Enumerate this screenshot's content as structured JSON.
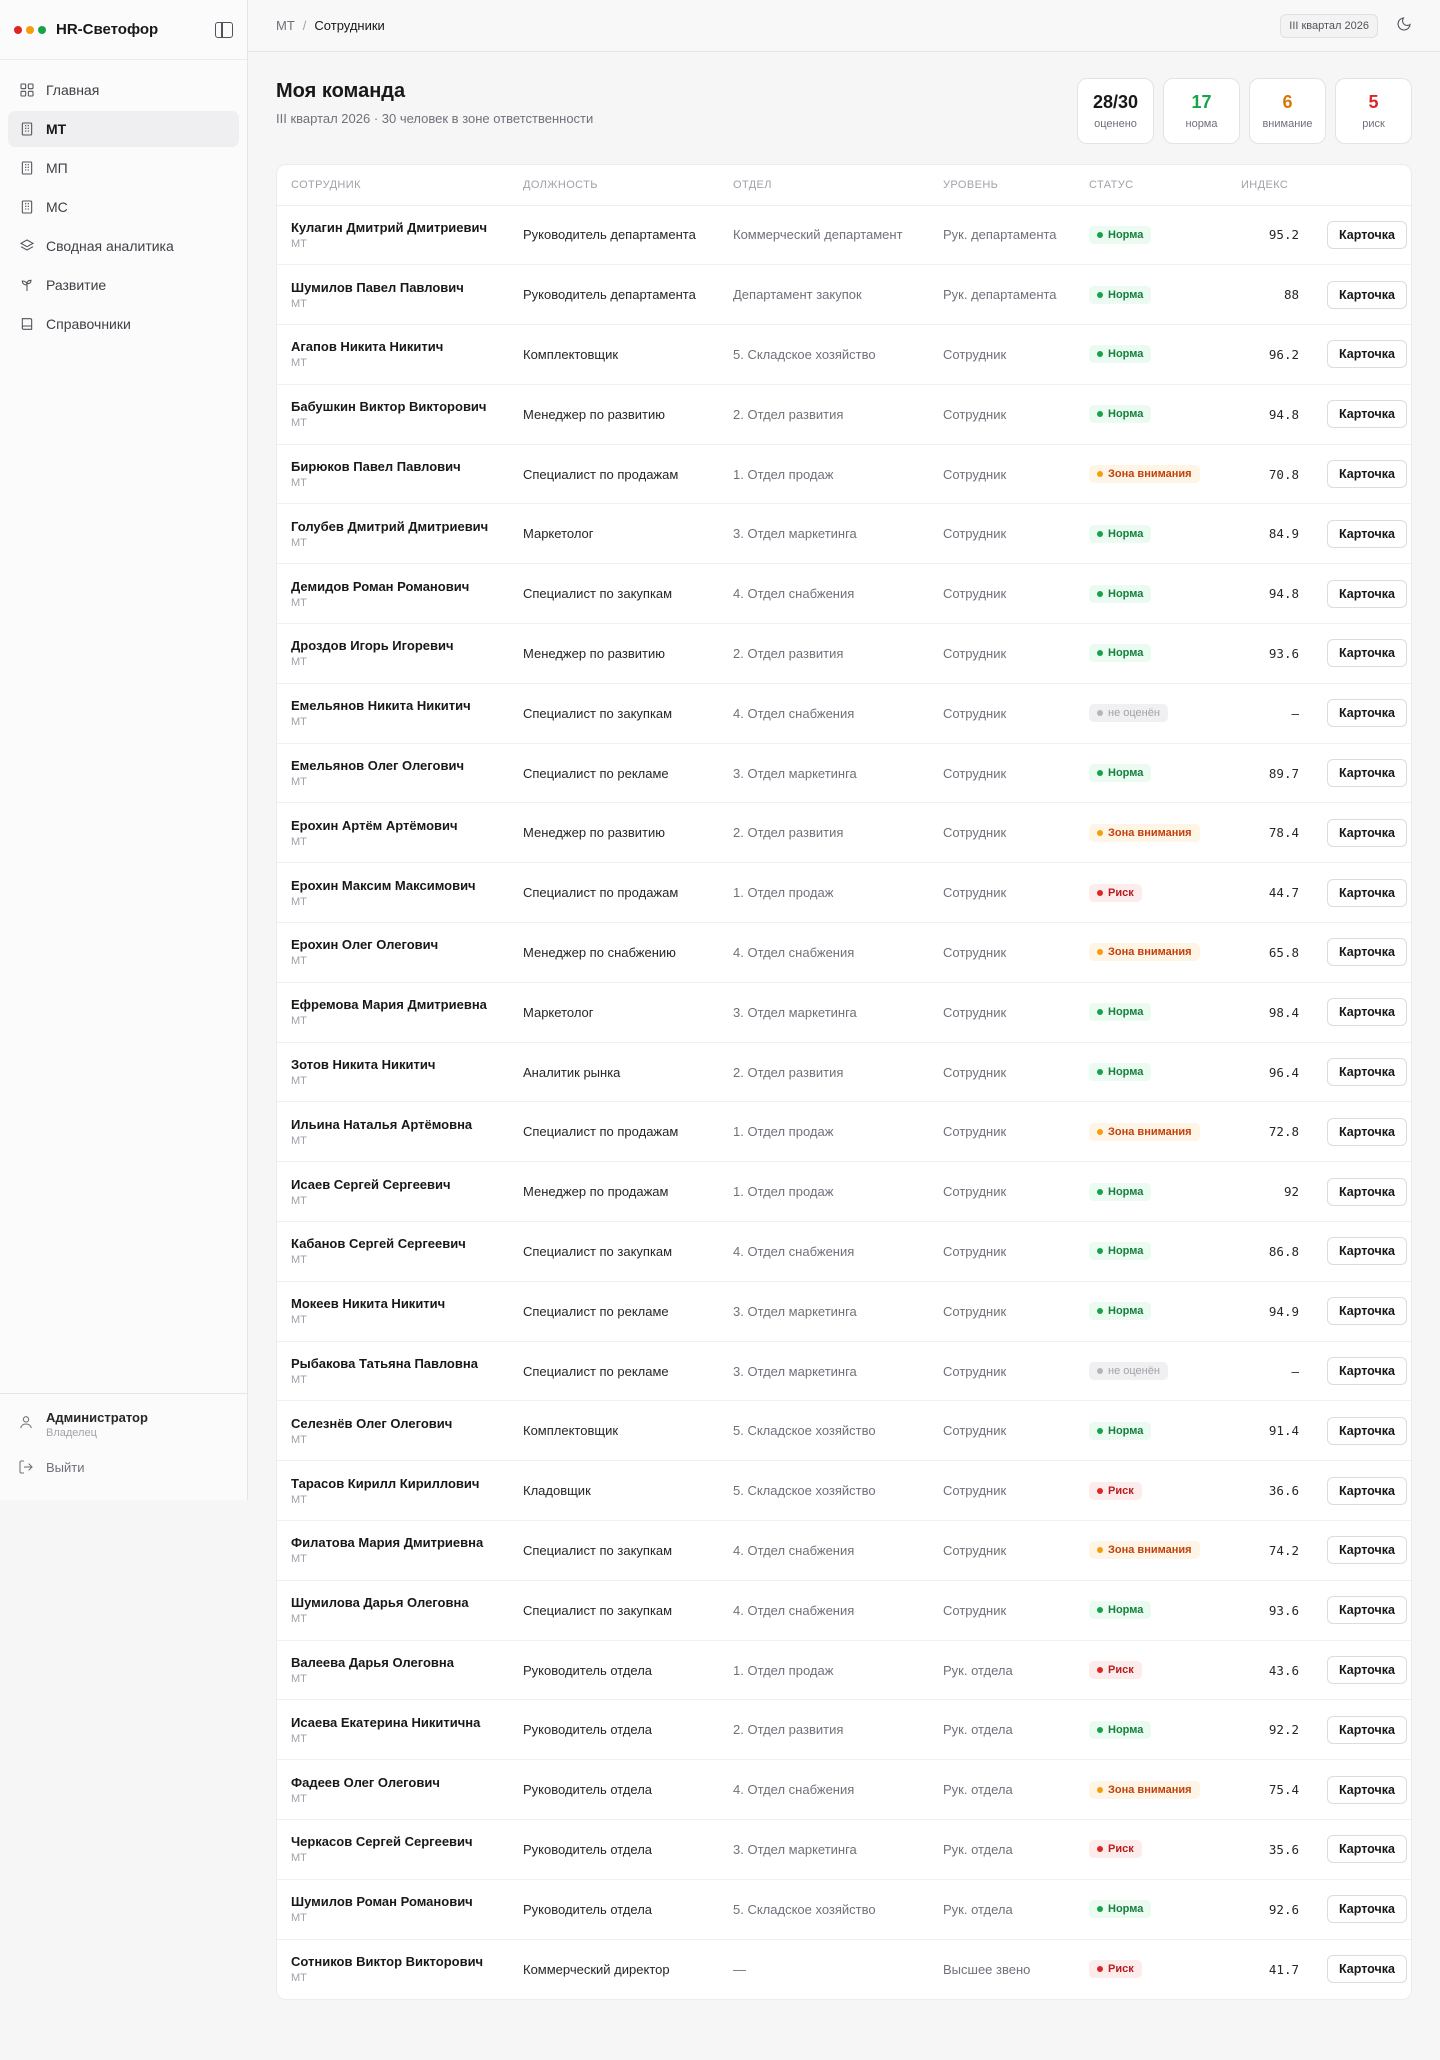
{
  "app": {
    "title": "HR-Светофор",
    "dots": [
      "#dc2626",
      "#f59e0b",
      "#16a34a"
    ]
  },
  "sidebar": {
    "items": [
      {
        "label": "Главная",
        "icon": "grid-icon",
        "active": false
      },
      {
        "label": "МТ",
        "icon": "building-icon",
        "active": true
      },
      {
        "label": "МП",
        "icon": "building-icon",
        "active": false
      },
      {
        "label": "МС",
        "icon": "building-icon",
        "active": false
      },
      {
        "label": "Сводная аналитика",
        "icon": "layers-icon",
        "active": false
      },
      {
        "label": "Развитие",
        "icon": "sprout-icon",
        "active": false
      },
      {
        "label": "Справочники",
        "icon": "book-icon",
        "active": false
      }
    ],
    "user": {
      "name": "Администратор",
      "role": "Владелец"
    },
    "logout": "Выйти"
  },
  "topbar": {
    "breadcrumb": [
      "МТ",
      "Сотрудники"
    ],
    "period": "III квартал 2026"
  },
  "page": {
    "title": "Моя команда",
    "subtitle": "III квартал 2026 · 30 человек в зоне ответственности",
    "stats": [
      {
        "value": "28/30",
        "label": "оценено",
        "color": "#18181b"
      },
      {
        "value": "17",
        "label": "норма",
        "color": "#16a34a"
      },
      {
        "value": "6",
        "label": "внимание",
        "color": "#d97706"
      },
      {
        "value": "5",
        "label": "риск",
        "color": "#dc2626"
      }
    ]
  },
  "table": {
    "columns": [
      "СОТРУДНИК",
      "ДОЛЖНОСТЬ",
      "ОТДЕЛ",
      "УРОВЕНЬ",
      "СТАТУС",
      "ИНДЕКС",
      ""
    ],
    "button_label": "Карточка",
    "rows": [
      {
        "name": "Кулагин Дмитрий Дмитриевич",
        "org": "МТ",
        "position": "Руководитель департамента",
        "dept": "Коммерческий департамент",
        "level": "Рук. департамента",
        "status": "Норма",
        "status_type": "norm",
        "index": "95.2"
      },
      {
        "name": "Шумилов Павел Павлович",
        "org": "МТ",
        "position": "Руководитель департамента",
        "dept": "Департамент закупок",
        "level": "Рук. департамента",
        "status": "Норма",
        "status_type": "norm",
        "index": "88"
      },
      {
        "name": "Агапов Никита Никитич",
        "org": "МТ",
        "position": "Комплектовщик",
        "dept": "5. Складское хозяйство",
        "level": "Сотрудник",
        "status": "Норма",
        "status_type": "norm",
        "index": "96.2"
      },
      {
        "name": "Бабушкин Виктор Викторович",
        "org": "МТ",
        "position": "Менеджер по развитию",
        "dept": "2. Отдел развития",
        "level": "Сотрудник",
        "status": "Норма",
        "status_type": "norm",
        "index": "94.8"
      },
      {
        "name": "Бирюков Павел Павлович",
        "org": "МТ",
        "position": "Специалист по продажам",
        "dept": "1. Отдел продаж",
        "level": "Сотрудник",
        "status": "Зона внимания",
        "status_type": "att",
        "index": "70.8"
      },
      {
        "name": "Голубев Дмитрий Дмитриевич",
        "org": "МТ",
        "position": "Маркетолог",
        "dept": "3. Отдел маркетинга",
        "level": "Сотрудник",
        "status": "Норма",
        "status_type": "norm",
        "index": "84.9"
      },
      {
        "name": "Демидов Роман Романович",
        "org": "МТ",
        "position": "Специалист по закупкам",
        "dept": "4. Отдел снабжения",
        "level": "Сотрудник",
        "status": "Норма",
        "status_type": "norm",
        "index": "94.8"
      },
      {
        "name": "Дроздов Игорь Игоревич",
        "org": "МТ",
        "position": "Менеджер по развитию",
        "dept": "2. Отдел развития",
        "level": "Сотрудник",
        "status": "Норма",
        "status_type": "norm",
        "index": "93.6"
      },
      {
        "name": "Емельянов Никита Никитич",
        "org": "МТ",
        "position": "Специалист по закупкам",
        "dept": "4. Отдел снабжения",
        "level": "Сотрудник",
        "status": "не оценён",
        "status_type": "none",
        "index": "—"
      },
      {
        "name": "Емельянов Олег Олегович",
        "org": "МТ",
        "position": "Специалист по рекламе",
        "dept": "3. Отдел маркетинга",
        "level": "Сотрудник",
        "status": "Норма",
        "status_type": "norm",
        "index": "89.7"
      },
      {
        "name": "Ерохин Артём Артёмович",
        "org": "МТ",
        "position": "Менеджер по развитию",
        "dept": "2. Отдел развития",
        "level": "Сотрудник",
        "status": "Зона внимания",
        "status_type": "att",
        "index": "78.4"
      },
      {
        "name": "Ерохин Максим Максимович",
        "org": "МТ",
        "position": "Специалист по продажам",
        "dept": "1. Отдел продаж",
        "level": "Сотрудник",
        "status": "Риск",
        "status_type": "risk",
        "index": "44.7"
      },
      {
        "name": "Ерохин Олег Олегович",
        "org": "МТ",
        "position": "Менеджер по снабжению",
        "dept": "4. Отдел снабжения",
        "level": "Сотрудник",
        "status": "Зона внимания",
        "status_type": "att",
        "index": "65.8"
      },
      {
        "name": "Ефремова Мария Дмитриевна",
        "org": "МТ",
        "position": "Маркетолог",
        "dept": "3. Отдел маркетинга",
        "level": "Сотрудник",
        "status": "Норма",
        "status_type": "norm",
        "index": "98.4"
      },
      {
        "name": "Зотов Никита Никитич",
        "org": "МТ",
        "position": "Аналитик рынка",
        "dept": "2. Отдел развития",
        "level": "Сотрудник",
        "status": "Норма",
        "status_type": "norm",
        "index": "96.4"
      },
      {
        "name": "Ильина Наталья Артёмовна",
        "org": "МТ",
        "position": "Специалист по продажам",
        "dept": "1. Отдел продаж",
        "level": "Сотрудник",
        "status": "Зона внимания",
        "status_type": "att",
        "index": "72.8"
      },
      {
        "name": "Исаев Сергей Сергеевич",
        "org": "МТ",
        "position": "Менеджер по продажам",
        "dept": "1. Отдел продаж",
        "level": "Сотрудник",
        "status": "Норма",
        "status_type": "norm",
        "index": "92"
      },
      {
        "name": "Кабанов Сергей Сергеевич",
        "org": "МТ",
        "position": "Специалист по закупкам",
        "dept": "4. Отдел снабжения",
        "level": "Сотрудник",
        "status": "Норма",
        "status_type": "norm",
        "index": "86.8"
      },
      {
        "name": "Мокеев Никита Никитич",
        "org": "МТ",
        "position": "Специалист по рекламе",
        "dept": "3. Отдел маркетинга",
        "level": "Сотрудник",
        "status": "Норма",
        "status_type": "norm",
        "index": "94.9"
      },
      {
        "name": "Рыбакова Татьяна Павловна",
        "org": "МТ",
        "position": "Специалист по рекламе",
        "dept": "3. Отдел маркетинга",
        "level": "Сотрудник",
        "status": "не оценён",
        "status_type": "none",
        "index": "—"
      },
      {
        "name": "Селезнёв Олег Олегович",
        "org": "МТ",
        "position": "Комплектовщик",
        "dept": "5. Складское хозяйство",
        "level": "Сотрудник",
        "status": "Норма",
        "status_type": "norm",
        "index": "91.4"
      },
      {
        "name": "Тарасов Кирилл Кириллович",
        "org": "МТ",
        "position": "Кладовщик",
        "dept": "5. Складское хозяйство",
        "level": "Сотрудник",
        "status": "Риск",
        "status_type": "risk",
        "index": "36.6"
      },
      {
        "name": "Филатова Мария Дмитриевна",
        "org": "МТ",
        "position": "Специалист по закупкам",
        "dept": "4. Отдел снабжения",
        "level": "Сотрудник",
        "status": "Зона внимания",
        "status_type": "att",
        "index": "74.2"
      },
      {
        "name": "Шумилова Дарья Олеговна",
        "org": "МТ",
        "position": "Специалист по закупкам",
        "dept": "4. Отдел снабжения",
        "level": "Сотрудник",
        "status": "Норма",
        "status_type": "norm",
        "index": "93.6"
      },
      {
        "name": "Валеева Дарья Олеговна",
        "org": "МТ",
        "position": "Руководитель отдела",
        "dept": "1. Отдел продаж",
        "level": "Рук. отдела",
        "status": "Риск",
        "status_type": "risk",
        "index": "43.6"
      },
      {
        "name": "Исаева Екатерина Никитична",
        "org": "МТ",
        "position": "Руководитель отдела",
        "dept": "2. Отдел развития",
        "level": "Рук. отдела",
        "status": "Норма",
        "status_type": "norm",
        "index": "92.2"
      },
      {
        "name": "Фадеев Олег Олегович",
        "org": "МТ",
        "position": "Руководитель отдела",
        "dept": "4. Отдел снабжения",
        "level": "Рук. отдела",
        "status": "Зона внимания",
        "status_type": "att",
        "index": "75.4"
      },
      {
        "name": "Черкасов Сергей Сергеевич",
        "org": "МТ",
        "position": "Руководитель отдела",
        "dept": "3. Отдел маркетинга",
        "level": "Рук. отдела",
        "status": "Риск",
        "status_type": "risk",
        "index": "35.6"
      },
      {
        "name": "Шумилов Роман Романович",
        "org": "МТ",
        "position": "Руководитель отдела",
        "dept": "5. Складское хозяйство",
        "level": "Рук. отдела",
        "status": "Норма",
        "status_type": "norm",
        "index": "92.6"
      },
      {
        "name": "Сотников Виктор Викторович",
        "org": "МТ",
        "position": "Коммерческий директор",
        "dept": "—",
        "level": "Высшее звено",
        "status": "Риск",
        "status_type": "risk",
        "index": "41.7"
      }
    ]
  }
}
